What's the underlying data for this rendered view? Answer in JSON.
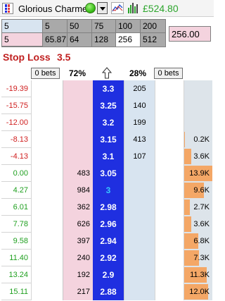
{
  "header": {
    "market_name": "Glorious Charmer",
    "balance": "£524.80",
    "icons": [
      "app-icon",
      "status-dot",
      "dropdown-icon",
      "chart-icon",
      "bar-chart-icon"
    ],
    "colors": {
      "balance": "#2ca52c",
      "status": "#3cc01a"
    }
  },
  "stakes": {
    "back_selected": "5",
    "lay_selected": "5",
    "back_row": [
      "5",
      "50",
      "75",
      "100",
      "200"
    ],
    "lay_row": [
      "65.87",
      "64",
      "128",
      "256",
      "512"
    ],
    "stake_value": "256.00"
  },
  "stop_loss": {
    "label": "Stop Loss",
    "value": "3.5"
  },
  "ladder_header": {
    "lay_bets": "0 bets",
    "lay_pct": "72%",
    "back_pct": "28%",
    "back_bets": "0 bets",
    "arrow_icon": "up-arrow-icon"
  },
  "ladder": {
    "rows": [
      {
        "pl": "-19.39",
        "lay": "",
        "price": "3.3",
        "back": "205",
        "vol": "",
        "vol_fraction": 0
      },
      {
        "pl": "-15.75",
        "lay": "",
        "price": "3.25",
        "back": "140",
        "vol": "",
        "vol_fraction": 0
      },
      {
        "pl": "-12.00",
        "lay": "",
        "price": "3.2",
        "back": "199",
        "vol": "",
        "vol_fraction": 0
      },
      {
        "pl": "-8.13",
        "lay": "",
        "price": "3.15",
        "back": "413",
        "vol": "0.2K",
        "vol_fraction": 0.02
      },
      {
        "pl": "-4.13",
        "lay": "",
        "price": "3.1",
        "back": "107",
        "vol": "3.6K",
        "vol_fraction": 0.26
      },
      {
        "pl": "0.00",
        "lay": "483",
        "price": "3.05",
        "back": "",
        "vol": "13.9K",
        "vol_fraction": 1.0
      },
      {
        "pl": "4.27",
        "lay": "984",
        "price": "3",
        "back": "",
        "vol": "9.6K",
        "vol_fraction": 0.69
      },
      {
        "pl": "6.01",
        "lay": "362",
        "price": "2.98",
        "back": "",
        "vol": "2.7K",
        "vol_fraction": 0.19
      },
      {
        "pl": "7.78",
        "lay": "626",
        "price": "2.96",
        "back": "",
        "vol": "3.6K",
        "vol_fraction": 0.26
      },
      {
        "pl": "9.58",
        "lay": "397",
        "price": "2.94",
        "back": "",
        "vol": "6.8K",
        "vol_fraction": 0.49
      },
      {
        "pl": "11.40",
        "lay": "240",
        "price": "2.92",
        "back": "",
        "vol": "7.3K",
        "vol_fraction": 0.53
      },
      {
        "pl": "13.24",
        "lay": "192",
        "price": "2.9",
        "back": "",
        "vol": "11.3K",
        "vol_fraction": 0.81
      },
      {
        "pl": "15.11",
        "lay": "217",
        "price": "2.88",
        "back": "",
        "vol": "12.0K",
        "vol_fraction": 0.86
      }
    ],
    "current_price_row": 6,
    "colors": {
      "price": "#1f2fe0",
      "lay": "#f4d3de",
      "back": "#d8e4f0",
      "volume": "#f4a766",
      "profit": "#20a020",
      "loss": "#d02020"
    }
  }
}
